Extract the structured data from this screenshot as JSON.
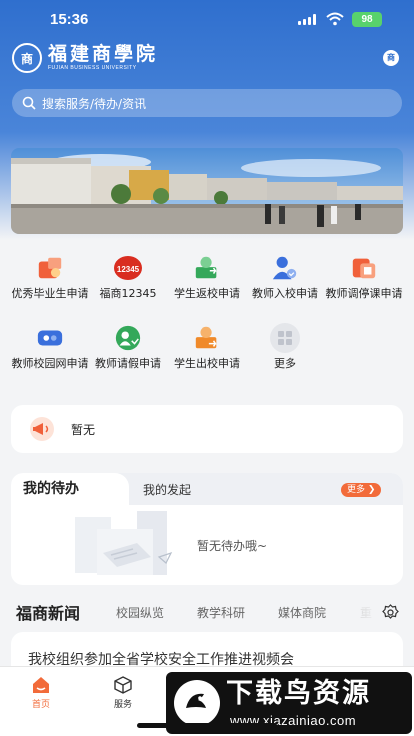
{
  "status_bar": {
    "time": "15:36",
    "battery": "98"
  },
  "header": {
    "logo_cn": "福建商學院",
    "logo_en": "FUJIAN BUSINESS UNIVERSITY",
    "seal_char": "商",
    "avatar_char": "商"
  },
  "search": {
    "placeholder": "搜索服务/待办/资讯"
  },
  "services": [
    {
      "label": "优秀毕业生申请",
      "icon": "graduate-award-icon",
      "color": "#f0603a"
    },
    {
      "label": "福商12345",
      "icon": "hotline-12345-icon",
      "color": "#d92d20"
    },
    {
      "label": "学生返校申请",
      "icon": "student-return-icon",
      "color": "#34a85a"
    },
    {
      "label": "教师入校申请",
      "icon": "teacher-enter-icon",
      "color": "#3a6fdc"
    },
    {
      "label": "教师调停课申请",
      "icon": "class-reschedule-icon",
      "color": "#f0603a"
    },
    {
      "label": "教师校园网申请",
      "icon": "campus-network-icon",
      "color": "#3a6fdc"
    },
    {
      "label": "教师请假申请",
      "icon": "leave-request-icon",
      "color": "#34a85a"
    },
    {
      "label": "学生出校申请",
      "icon": "student-exit-icon",
      "color": "#f08a2a"
    },
    {
      "label": "更多",
      "icon": "more-grid-icon",
      "color": "#bfc3cc"
    }
  ],
  "notice": {
    "text": "暂无"
  },
  "todo": {
    "tab_active": "我的待办",
    "tab_inactive": "我的发起",
    "more_label": "更多",
    "empty_text": "暂无待办哦~"
  },
  "news": {
    "title": "福商新闻",
    "tabs": [
      "校园纵览",
      "教学科研",
      "媒体商院",
      "重"
    ],
    "headline": "我校组织参加全省学校安全工作推进视频会"
  },
  "bottom_nav": [
    {
      "label": "首页",
      "icon": "home-icon",
      "active": true
    },
    {
      "label": "服务",
      "icon": "service-box-icon",
      "active": false
    }
  ],
  "watermark": {
    "text": "下载鸟资源",
    "url": "www.xiazainiao.com"
  },
  "colors": {
    "primary": "#2f6fce",
    "accent": "#f26b3a"
  }
}
